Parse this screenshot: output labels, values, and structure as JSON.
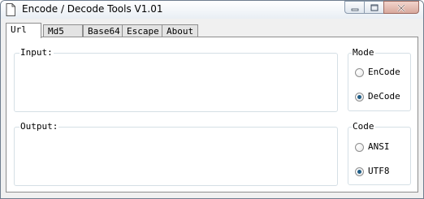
{
  "window": {
    "title": "Encode / Decode Tools V1.01"
  },
  "tabs": [
    {
      "label": "Url",
      "active": true
    },
    {
      "label": "Md5",
      "active": false
    },
    {
      "label": "Base64",
      "active": false
    },
    {
      "label": "Escape",
      "active": false
    },
    {
      "label": "About",
      "active": false
    }
  ],
  "input": {
    "label": "Input:",
    "value": ""
  },
  "output": {
    "label": "Output:",
    "value": ""
  },
  "mode": {
    "label": "Mode",
    "options": [
      "EnCode",
      "DeCode"
    ],
    "selected": "DeCode"
  },
  "code": {
    "label": "Code",
    "options": [
      "ANSI",
      "UTF8"
    ],
    "selected": "UTF8"
  },
  "colors": {
    "accent": "#1f5d86",
    "border": "#8e8e8e",
    "group_border": "#d5dfe5",
    "panel_bg": "#ffffff",
    "window_bg": "#f0f0f0"
  },
  "icons": {
    "app": "app-page-icon",
    "min": "minimize-icon",
    "max": "maximize-icon",
    "close": "close-icon"
  }
}
